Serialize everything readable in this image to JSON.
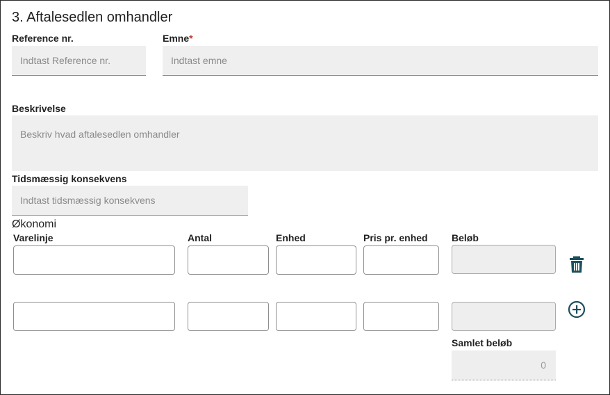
{
  "section": {
    "title": "3. Aftalesedlen omhandler"
  },
  "reference": {
    "label": "Reference nr.",
    "placeholder": "Indtast Reference nr.",
    "value": ""
  },
  "emne": {
    "label": "Emne",
    "required_mark": "*",
    "placeholder": "Indtast emne",
    "value": ""
  },
  "beskrivelse": {
    "label": "Beskrivelse",
    "placeholder": "Beskriv hvad aftalesedlen omhandler",
    "value": ""
  },
  "tids": {
    "label": "Tidsmæssig konsekvens",
    "placeholder": "Indtast tidsmæssig konsekvens",
    "value": ""
  },
  "okonomi": {
    "title": "Økonomi",
    "columns": {
      "varelinje": "Varelinje",
      "antal": "Antal",
      "enhed": "Enhed",
      "pris": "Pris pr. enhed",
      "belob": "Beløb"
    },
    "rows": [
      {
        "varelinje": "",
        "antal": "",
        "enhed": "",
        "pris": "",
        "belob": ""
      },
      {
        "varelinje": "",
        "antal": "",
        "enhed": "",
        "pris": "",
        "belob": ""
      }
    ],
    "total_label": "Samlet beløb",
    "total_value": "0"
  },
  "icons": {
    "delete": "trash-icon",
    "add": "plus-circle-icon"
  },
  "colors": {
    "icon": "#1c4f5c",
    "required": "#c0392b",
    "field_bg": "#efefef"
  }
}
